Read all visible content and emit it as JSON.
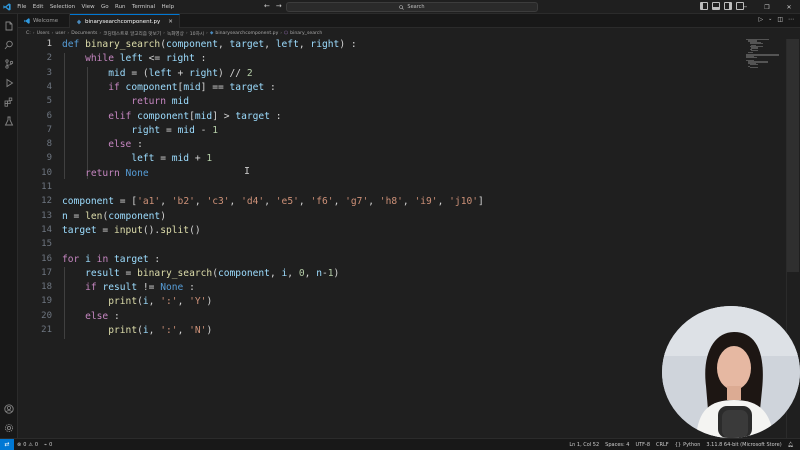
{
  "menu": [
    "File",
    "Edit",
    "Selection",
    "View",
    "Go",
    "Run",
    "Terminal",
    "Help"
  ],
  "search": {
    "placeholder": "Search"
  },
  "tabs": [
    {
      "label": "Welcome",
      "active": false
    },
    {
      "label": "binarysearchcomponent.py",
      "active": true
    }
  ],
  "breadcrumb": [
    "C:",
    "Users",
    "user",
    "Documents",
    "코딩테스트로 알고리즘 맛보기",
    "녹화영상",
    "10차시",
    "binarysearchcomponent.py",
    "binary_search"
  ],
  "editor": {
    "line_numbers": [
      "1",
      "2",
      "3",
      "4",
      "5",
      "6",
      "7",
      "8",
      "9",
      "10",
      "11",
      "12",
      "13",
      "14",
      "15",
      "16",
      "17",
      "18",
      "19",
      "20",
      "21"
    ],
    "current_line": 1
  },
  "statusbar": {
    "errors": "0",
    "warnings": "0",
    "ports": "0",
    "position": "Ln 1, Col 52",
    "spaces": "Spaces: 4",
    "encoding": "UTF-8",
    "eol": "CRLF",
    "language": "Python",
    "interpreter": "3.11.8 64-bit (Microsoft Store)"
  },
  "colors": {
    "accent": "#0078d4",
    "keyword": "#569cd6",
    "control": "#c586c0",
    "function": "#dcdcaa",
    "variable": "#9cdcfe",
    "number": "#b5cea8",
    "string": "#ce9178"
  },
  "icons": [
    "vscode-logo-icon",
    "explorer-icon",
    "search-icon",
    "source-control-icon",
    "run-debug-icon",
    "extensions-icon",
    "testing-icon",
    "account-icon",
    "settings-gear-icon"
  ]
}
